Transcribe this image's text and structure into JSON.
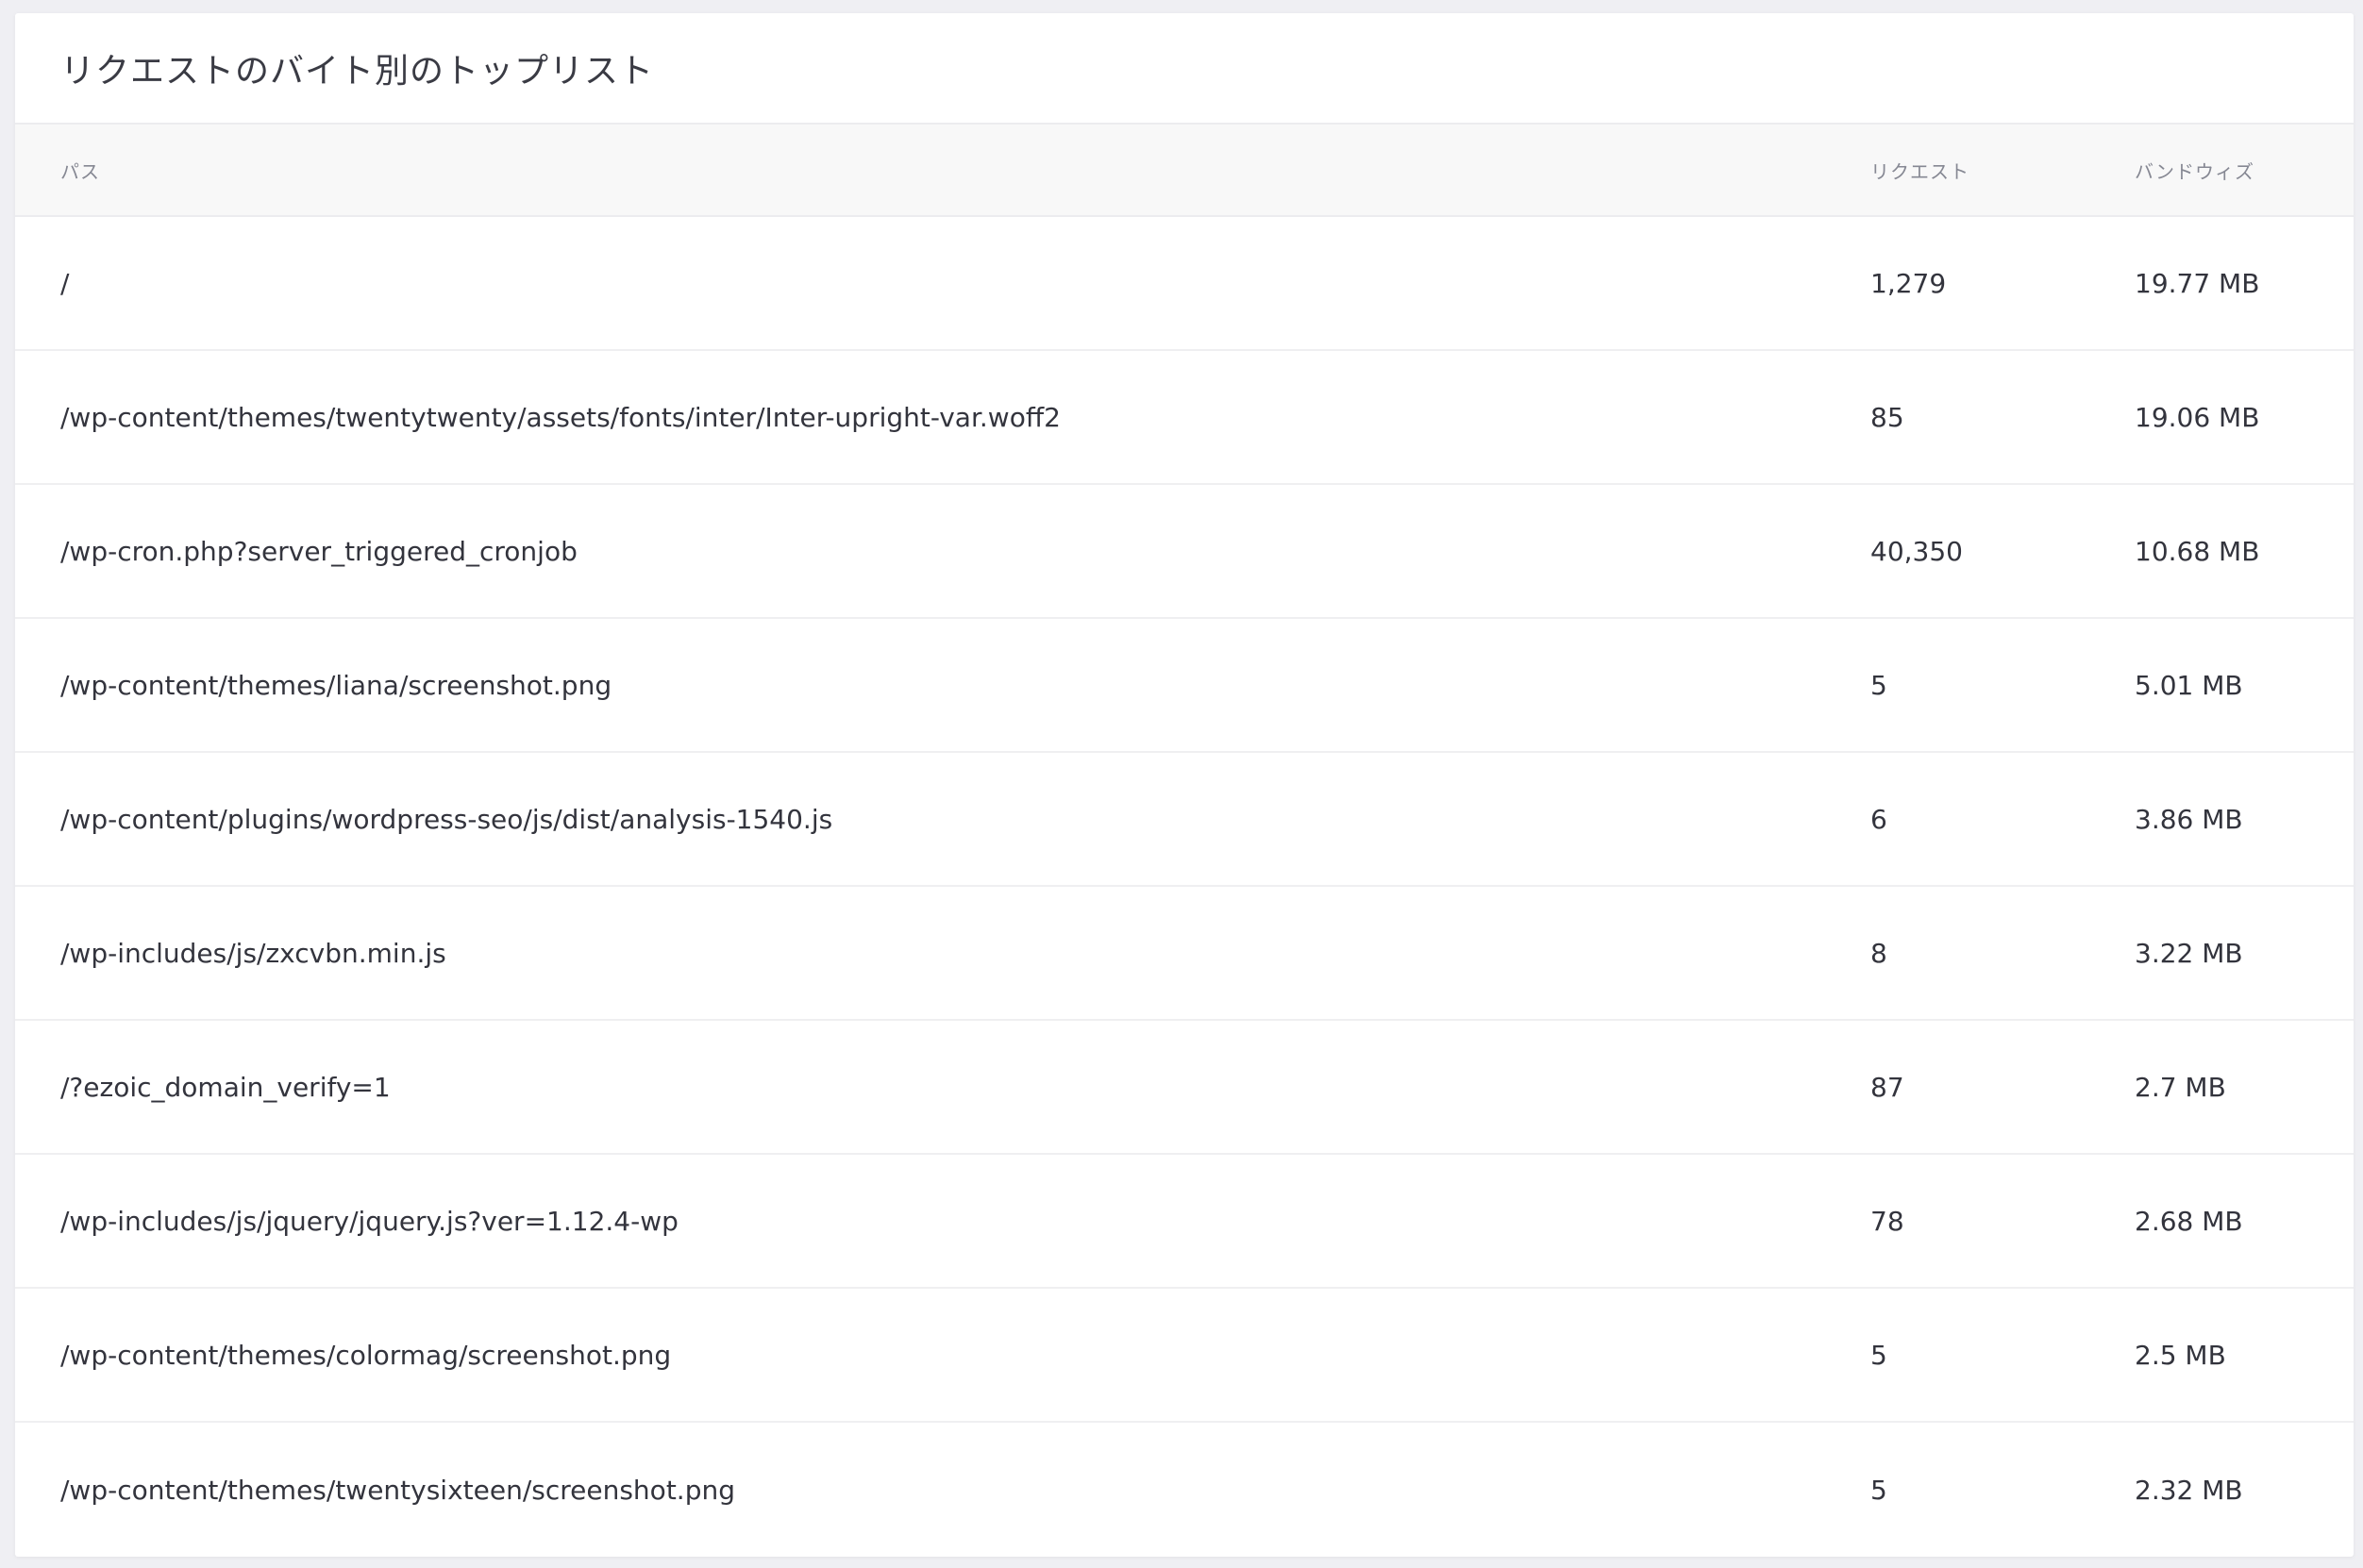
{
  "title": "リクエストのバイト別のトップリスト",
  "columns": {
    "path": "パス",
    "requests": "リクエスト",
    "bandwidth": "バンドウィズ"
  },
  "rows": [
    {
      "path": "/",
      "requests": "1,279",
      "bandwidth": "19.77 MB"
    },
    {
      "path": "/wp-content/themes/twentytwenty/assets/fonts/inter/Inter-upright-var.woff2",
      "requests": "85",
      "bandwidth": "19.06 MB"
    },
    {
      "path": "/wp-cron.php?server_triggered_cronjob",
      "requests": "40,350",
      "bandwidth": "10.68 MB"
    },
    {
      "path": "/wp-content/themes/liana/screenshot.png",
      "requests": "5",
      "bandwidth": "5.01 MB"
    },
    {
      "path": "/wp-content/plugins/wordpress-seo/js/dist/analysis-1540.js",
      "requests": "6",
      "bandwidth": "3.86 MB"
    },
    {
      "path": "/wp-includes/js/zxcvbn.min.js",
      "requests": "8",
      "bandwidth": "3.22 MB"
    },
    {
      "path": "/?ezoic_domain_verify=1",
      "requests": "87",
      "bandwidth": "2.7 MB"
    },
    {
      "path": "/wp-includes/js/jquery/jquery.js?ver=1.12.4-wp",
      "requests": "78",
      "bandwidth": "2.68 MB"
    },
    {
      "path": "/wp-content/themes/colormag/screenshot.png",
      "requests": "5",
      "bandwidth": "2.5 MB"
    },
    {
      "path": "/wp-content/themes/twentysixteen/screenshot.png",
      "requests": "5",
      "bandwidth": "2.32 MB"
    }
  ]
}
